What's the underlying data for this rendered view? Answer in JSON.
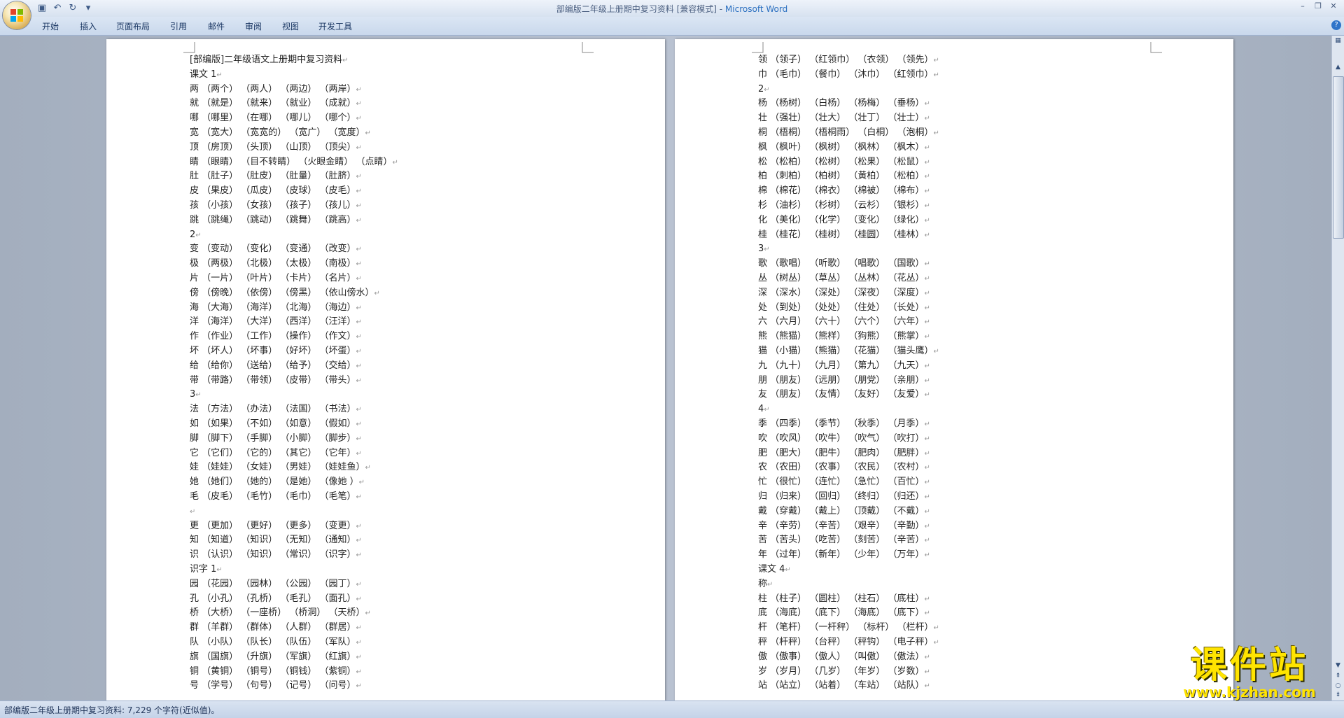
{
  "window": {
    "title_doc": "部编版二年级上册期中复习资料 [兼容模式] - ",
    "title_app": "Microsoft Word"
  },
  "qat": {
    "save_icon": "save-icon",
    "undo_icon": "undo-icon",
    "redo_icon": "redo-icon",
    "customize_icon": "chevron-down-icon"
  },
  "menu": {
    "tabs": [
      {
        "label": "开始"
      },
      {
        "label": "插入"
      },
      {
        "label": "页面布局"
      },
      {
        "label": "引用"
      },
      {
        "label": "邮件"
      },
      {
        "label": "审阅"
      },
      {
        "label": "视图"
      },
      {
        "label": "开发工具"
      }
    ]
  },
  "page1": {
    "lines": [
      "[部编版]二年级语文上册期中复习资料",
      "课文 1",
      "两 （两个） （两人） （两边） （两岸）",
      "就 （就是） （就来） （就业） （成就）",
      "哪 （哪里） （在哪） （哪儿） （哪个）",
      "宽 （宽大） （宽宽的） （宽广） （宽度）",
      "顶 （房顶） （头顶） （山顶） （顶尖）",
      "睛 （眼睛） （目不转睛） （火眼金睛） （点睛）",
      "肚 （肚子） （肚皮） （肚量） （肚脐）",
      "皮 （果皮） （瓜皮） （皮球） （皮毛）",
      "孩 （小孩） （女孩） （孩子） （孩儿）",
      "跳 （跳绳） （跳动） （跳舞） （跳高）",
      "2",
      "变 （变动） （变化） （变通） （改变）",
      "极 （两极） （北极） （太极） （南极）",
      "片 （一片） （叶片） （卡片） （名片）",
      "傍 （傍晚） （依傍） （傍黑） （依山傍水）",
      "海 （大海） （海洋） （北海） （海边）",
      "洋 （海洋） （大洋） （西洋） （汪洋）",
      "作 （作业） （工作） （操作） （作文）",
      "坏 （坏人） （坏事） （好坏） （坏蛋）",
      "给 （给你） （送给） （给予） （交给）",
      "带 （带路） （带领） （皮带） （带头）",
      "3",
      "法 （方法） （办法） （法国） （书法）",
      "如 （如果） （不如） （如意） （假如）",
      "脚 （脚下） （手脚） （小脚） （脚步）",
      "它 （它们） （它的） （其它） （它年）",
      "娃 （娃娃） （女娃） （男娃） （娃娃鱼）",
      "她 （她们） （她的） （是她） （像她 ）",
      "毛 （皮毛） （毛竹） （毛巾） （毛笔）",
      "",
      "更 （更加） （更好） （更多） （变更）",
      "知 （知道） （知识） （无知） （通知）",
      "识 （认识） （知识） （常识） （识字）",
      "识字 1",
      "园 （花园） （园林） （公园） （园丁）",
      "孔 （小孔） （孔桥） （毛孔） （面孔）",
      "桥 （大桥） （一座桥） （桥洞） （天桥）",
      "群 （羊群） （群体） （人群） （群居）",
      "队 （小队） （队长） （队伍） （军队）",
      "旗 （国旗） （升旗） （军旗） （红旗）",
      "铜 （黄铜） （铜号） （铜钱） （紫铜）",
      "号 （学号） （句号） （记号） （问号）"
    ]
  },
  "page2": {
    "lines": [
      "领 （领子） （红领巾） （衣领） （领先）",
      "巾 （毛巾） （餐巾） （沐巾） （红领巾）",
      "2",
      "杨 （杨树） （白杨） （杨梅） （垂杨）",
      "壮 （强壮） （壮大） （壮丁） （壮士）",
      "桐 （梧桐） （梧桐雨） （白桐） （泡桐）",
      "枫 （枫叶） （枫树） （枫林） （枫木）",
      "松 （松柏） （松树） （松果） （松鼠）",
      "柏 （刺柏） （柏树） （黄柏） （松柏）",
      "棉 （棉花） （棉衣） （棉被） （棉布）",
      "杉 （油杉） （杉树） （云杉） （银杉）",
      "化 （美化） （化学） （变化） （绿化）",
      "桂 （桂花） （桂树） （桂圆） （桂林）",
      "3",
      "歌 （歌唱） （听歌） （唱歌） （国歌）",
      "丛 （树丛） （草丛） （丛林） （花丛）",
      "深 （深水） （深处） （深夜） （深度）",
      "处 （到处） （处处） （住处） （长处）",
      "六 （六月） （六十） （六个） （六年）",
      "熊 （熊猫） （熊样） （狗熊） （熊掌）",
      "猫 （小猫） （熊猫） （花猫） （猫头鹰）",
      "九 （九十） （九月） （第九） （九天）",
      "朋 （朋友） （远朋） （朋党） （亲朋）",
      "友 （朋友） （友情） （友好） （友爱）",
      "4",
      "季 （四季） （季节） （秋季） （月季）",
      "吹 （吹风） （吹牛） （吹气） （吹打）",
      "肥 （肥大） （肥牛） （肥肉） （肥胖）",
      "农 （农田） （农事） （农民） （农村）",
      "忙 （很忙） （连忙） （急忙） （百忙）",
      "归 （归来） （回归） （终归） （归还）",
      "戴 （穿戴） （戴上） （顶戴） （不戴）",
      "辛 （辛劳） （辛苦） （艰辛） （辛勤）",
      "苦 （苦头） （吃苦） （刻苦） （辛苦）",
      "年 （过年） （新年） （少年） （万年）",
      "课文 4",
      "称",
      "柱 （柱子） （圆柱） （柱石） （底柱）",
      "底 （海底） （底下） （海底） （底下）",
      "杆 （笔杆） （一杆秤） （标杆） （栏杆）",
      "秤 （杆秤） （台秤） （秤钩） （电子秤）",
      "傲 （傲事） （傲人） （叫傲） （傲法）",
      "岁 （岁月） （几岁） （年岁） （岁数）",
      "站 （站立） （站着） （车站） （站队）"
    ]
  },
  "status": {
    "text": "部编版二年级上册期中复习资料: 7,229 个字符(近似值)。"
  },
  "watermark": {
    "title": "课件站",
    "url": "www.kjzhan.com"
  }
}
